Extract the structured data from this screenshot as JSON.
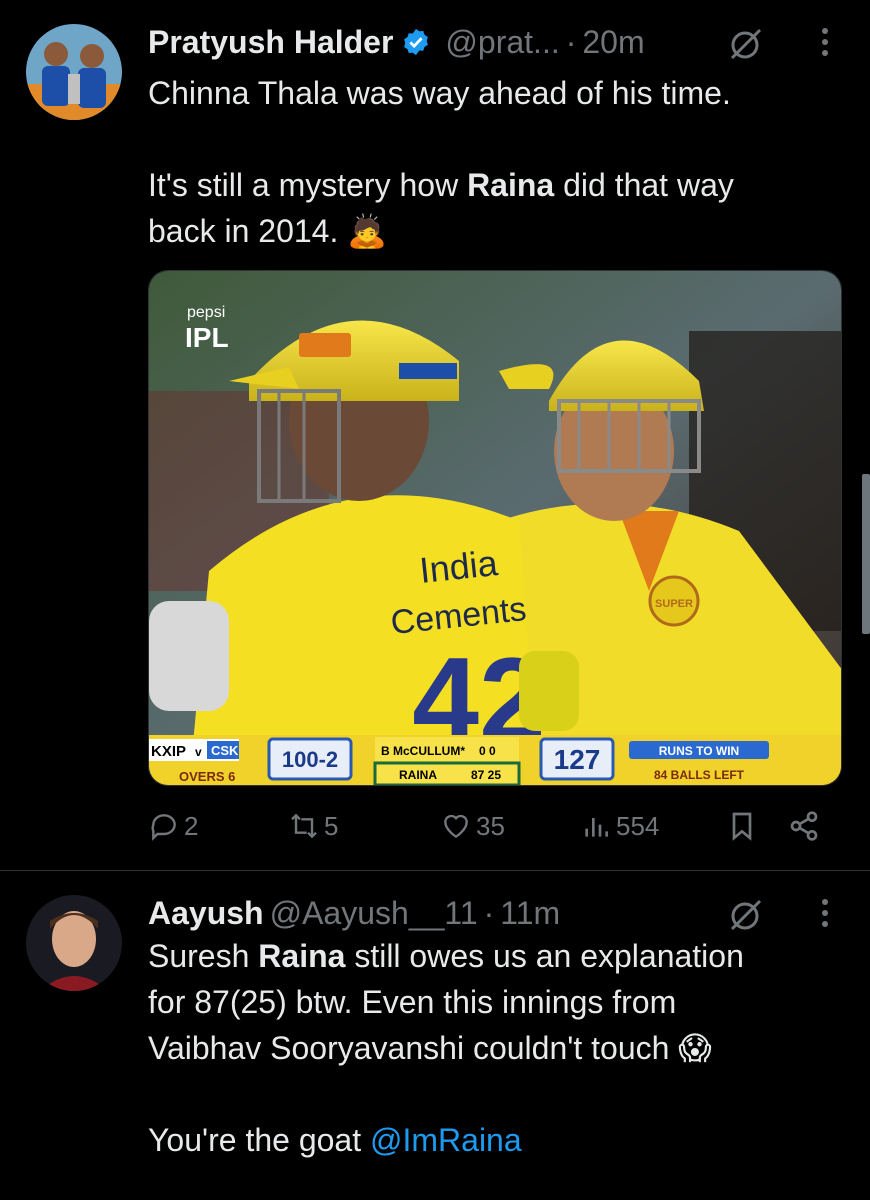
{
  "tweet1": {
    "author_name": "Pratyush Halder",
    "handle": "@prat...",
    "separator": "·",
    "time": "20m",
    "line1": "Chinna Thala was way ahead of his time.",
    "line2_pre": "It's still a mystery how ",
    "line2_bold": "Raina",
    "line2_post": " did that way",
    "line3": "back in 2014. 🙇",
    "media": {
      "logo_brand": "pepsi",
      "logo_league": "IPL",
      "jersey_text_1": "India",
      "jersey_text_2": "Cements",
      "jersey_number": "42",
      "scorebar": {
        "team1": "KXIP",
        "vs": "v",
        "team2": "CSK",
        "overs": "OVERS 6",
        "score": "100-2",
        "batter1": "B McCULLUM*",
        "batter1_score": "0 0",
        "batter2": "RAINA",
        "batter2_score": "87 25",
        "target": "127",
        "runs_to_win": "RUNS TO WIN",
        "balls_left": "84 BALLS LEFT"
      }
    },
    "stats": {
      "replies": "2",
      "retweets": "5",
      "likes": "35",
      "views": "554"
    }
  },
  "tweet2": {
    "author_name": "Aayush",
    "handle": "@Aayush__11",
    "separator": "·",
    "time": "11m",
    "line1_pre": "Suresh ",
    "line1_bold": "Raina",
    "line1_post": " still owes us an explanation",
    "line2": "for 87(25) btw. Even this innings from",
    "line3": "Vaibhav Sooryavanshi couldn't touch 😱",
    "line4_pre": "You're the goat ",
    "line4_link": "@ImRaina"
  },
  "colors": {
    "background": "#000000",
    "text": "#e7e9ea",
    "muted": "#71767b",
    "link": "#1d9bf0",
    "verified": "#1d9bf0",
    "csk_yellow": "#f4e01b"
  }
}
